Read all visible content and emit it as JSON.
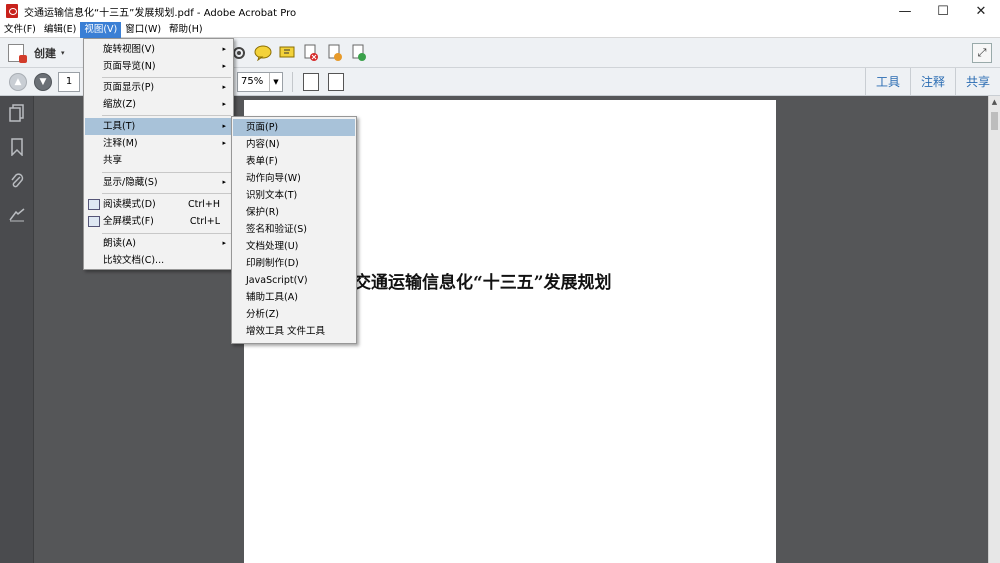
{
  "window": {
    "title": "交通运输信息化“十三五”发展规划.pdf - Adobe Acrobat Pro",
    "minimize": "—",
    "maximize": "☐",
    "close": "✕"
  },
  "menubar": {
    "items": [
      "文件(F)",
      "编辑(E)",
      "视图(V)",
      "窗口(W)",
      "帮助(H)"
    ],
    "active_index": 2
  },
  "toolbar": {
    "create_label": "创建",
    "create_caret": "▾",
    "icons": [
      "gear-icon",
      "comment-icon",
      "highlight-icon",
      "delete-page-icon",
      "export-icon",
      "share-file-icon"
    ],
    "page_number": "1",
    "zoom": "75%",
    "right_tabs": [
      "工具",
      "注释",
      "共享"
    ]
  },
  "view_menu": {
    "items": [
      {
        "label": "旋转视图(V)",
        "arrow": "▸"
      },
      {
        "label": "页面导览(N)",
        "arrow": "▸"
      },
      {
        "label": "页面显示(P)",
        "arrow": "▸"
      },
      {
        "label": "缩放(Z)",
        "arrow": "▸"
      },
      {
        "label": "工具(T)",
        "arrow": "▸"
      },
      {
        "label": "注释(M)",
        "arrow": "▸"
      },
      {
        "label": "共享"
      },
      {
        "label": "显示/隐藏(S)",
        "arrow": "▸"
      },
      {
        "label": "阅读模式(D)",
        "shortcut": "Ctrl+H"
      },
      {
        "label": "全屏模式(F)",
        "shortcut": "Ctrl+L"
      },
      {
        "label": "朗读(A)",
        "arrow": "▸"
      },
      {
        "label": "比较文档(C)..."
      }
    ]
  },
  "tools_menu": {
    "items": [
      "页面(P)",
      "内容(N)",
      "表单(F)",
      "动作向导(W)",
      "识别文本(T)",
      "保护(R)",
      "签名和验证(S)",
      "文档处理(U)",
      "印刷制作(D)",
      "JavaScript(V)",
      "辅助工具(A)",
      "分析(Z)",
      "增效工具 文件工具"
    ]
  },
  "document": {
    "title": "交通运输信息化“十三五”发展规划"
  }
}
